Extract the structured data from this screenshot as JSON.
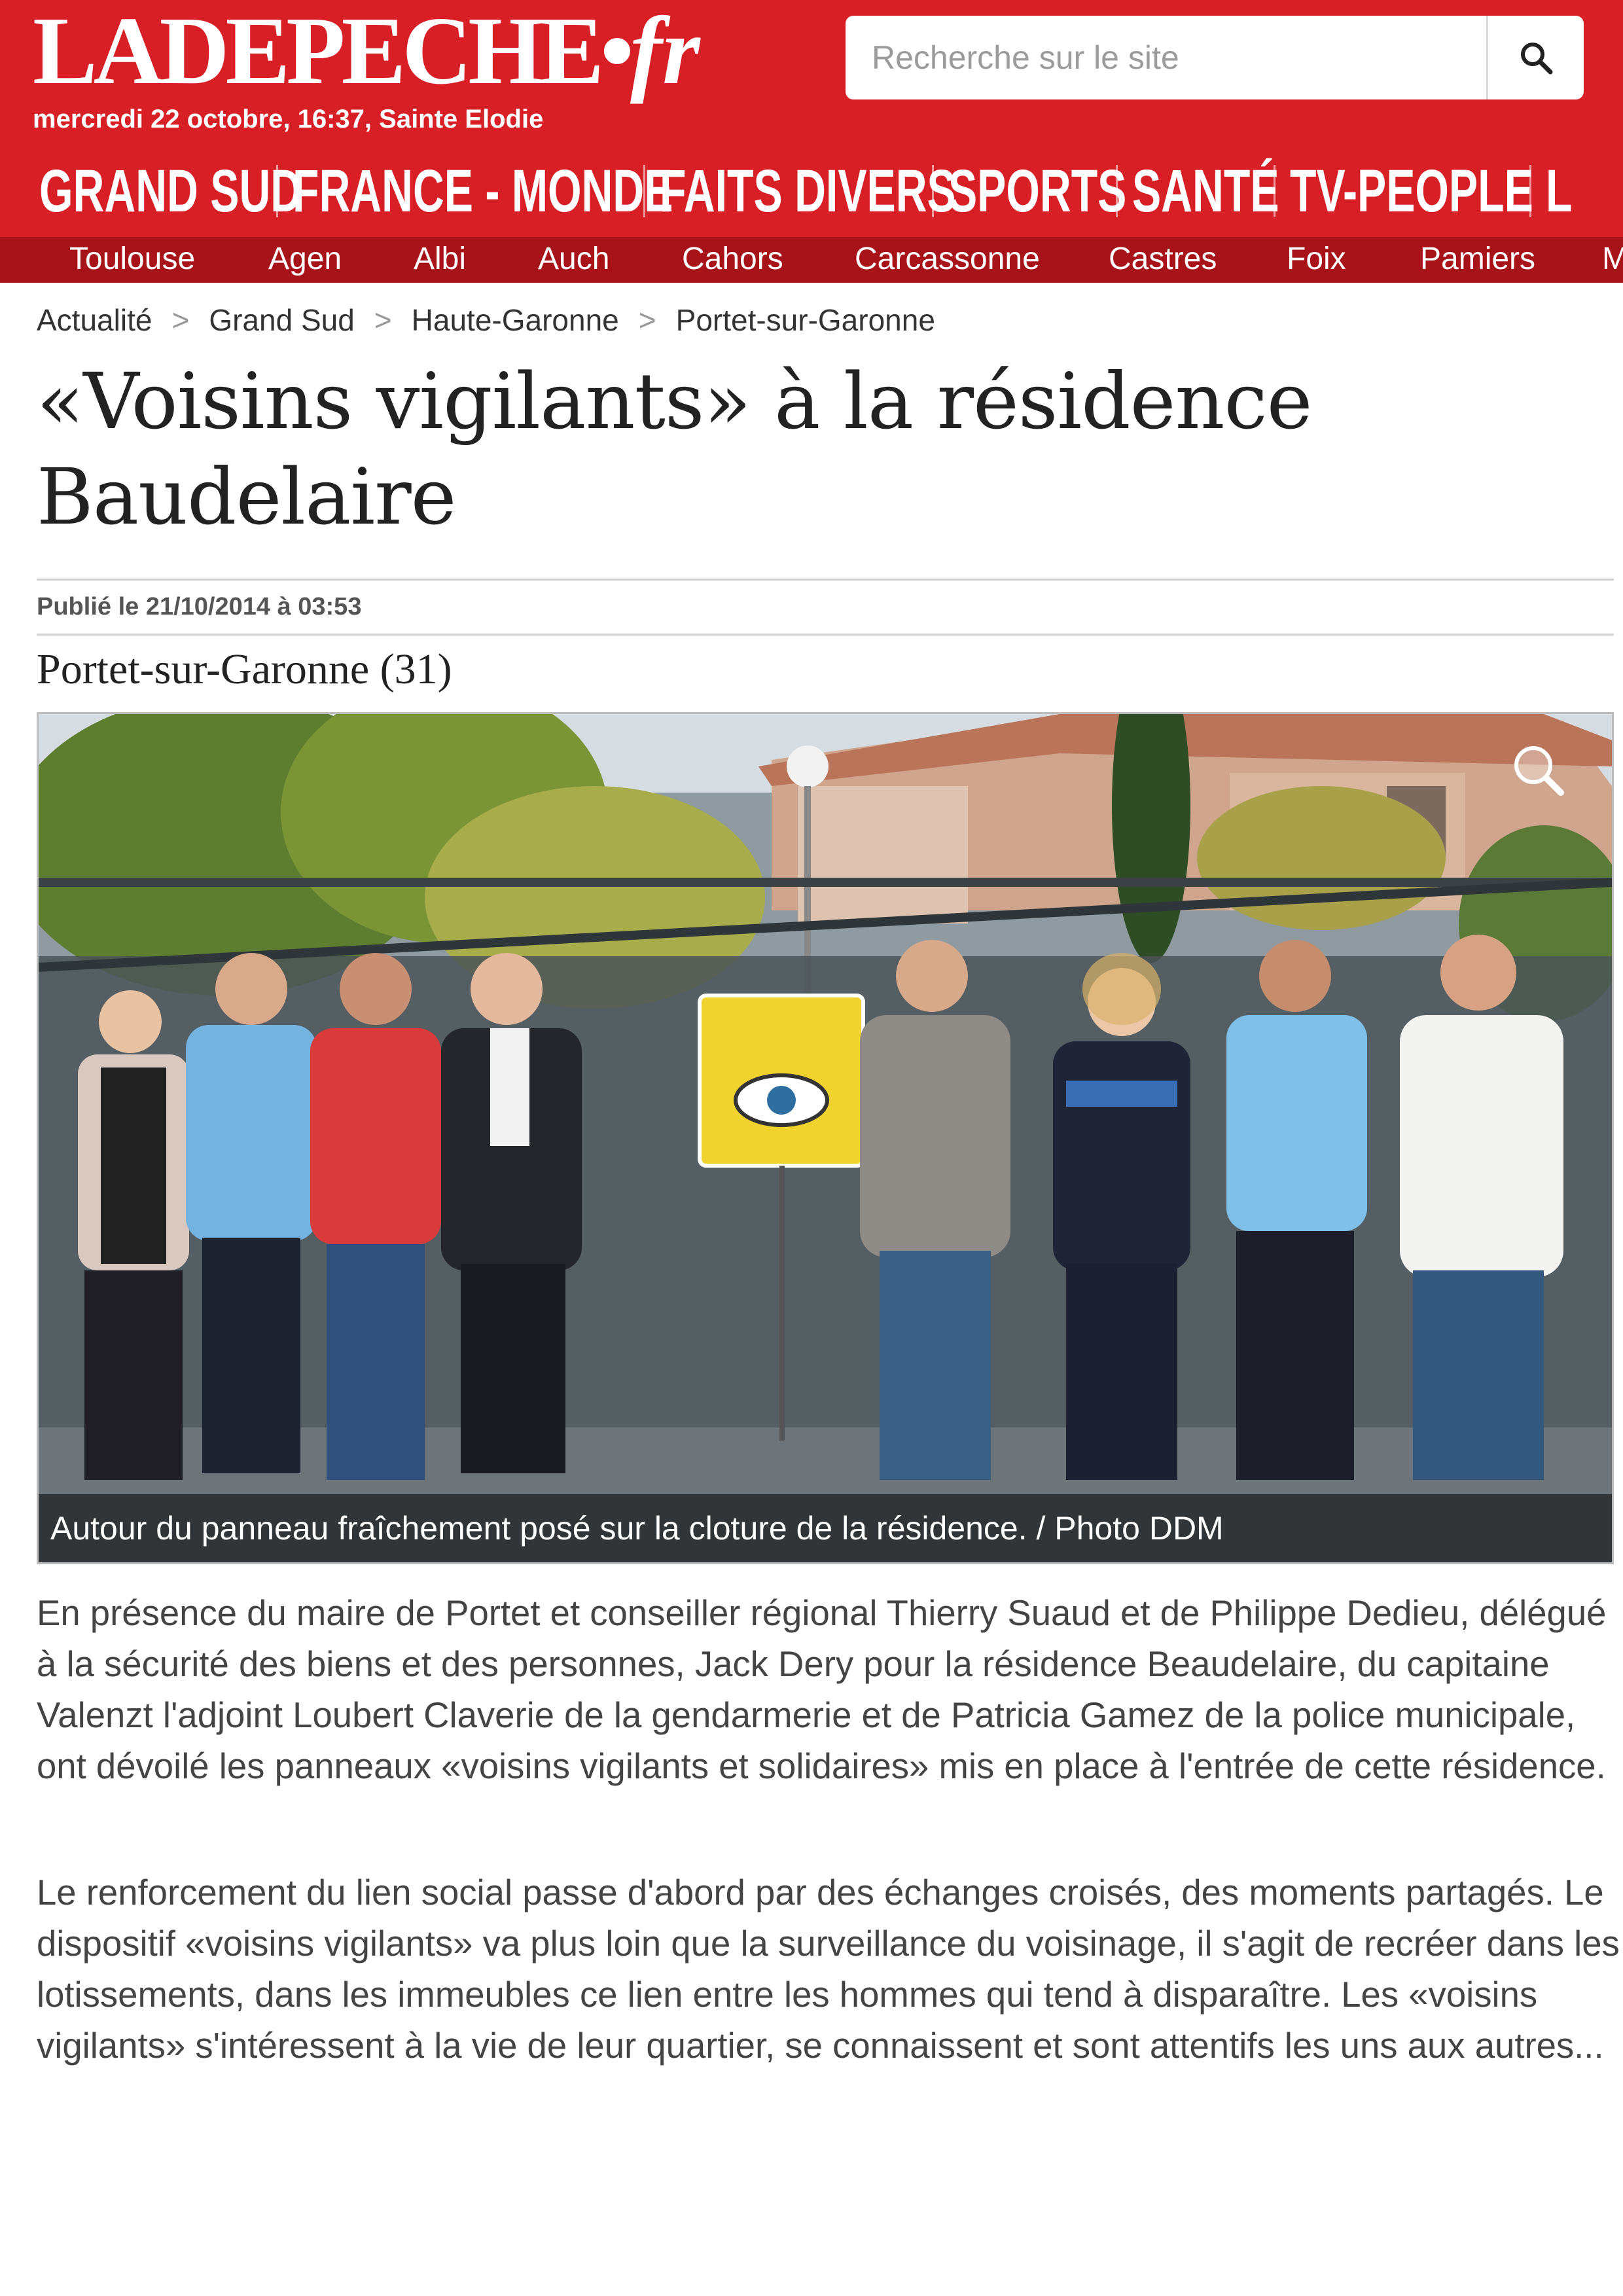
{
  "header": {
    "logo_main": "LADEPECHE",
    "logo_dot": "•",
    "logo_fr": "fr",
    "date_line": "mercredi 22 octobre, 16:37, Sainte Elodie",
    "search_placeholder": "Recherche sur le site",
    "search_icon": "magnifier-icon",
    "brand_color": "#d81f26",
    "subnav_color": "#a81219"
  },
  "main_nav": [
    "GRAND SUD",
    "FRANCE - MONDE",
    "FAITS DIVERS",
    "SPORTS",
    "SANTÉ",
    "TV-PEOPLE",
    "L"
  ],
  "sub_nav": [
    "Toulouse",
    "Agen",
    "Albi",
    "Auch",
    "Cahors",
    "Carcassonne",
    "Castres",
    "Foix",
    "Pamiers",
    "M"
  ],
  "breadcrumb": [
    "Actualité",
    "Grand Sud",
    "Haute-Garonne",
    "Portet-sur-Garonne"
  ],
  "breadcrumb_separator": ">",
  "article": {
    "title": "«Voisins vigilants» à la résidence Baudelaire",
    "published": "Publié le 21/10/2014 à 03:53",
    "location": "Portet-sur-Garonne (31)",
    "photo_caption": "Autour du panneau fraîchement posé sur la cloture de la résidence. / Photo DDM",
    "paragraphs": [
      "En présence du maire de Portet et conseiller régional Thierry Suaud et de Philippe Dedieu, délégué à la sécurité des biens et des personnes, Jack Dery pour la résidence Beaudelaire, du capitaine Valenzt l'adjoint Loubert Claverie de la gendarmerie et de Patricia Gamez de la police municipale, ont dévoilé les panneaux «voisins vigilants et solidaires» mis en place à l'entrée de cette résidence.",
      "Le renforcement du lien social passe d'abord par des échanges croisés, des moments partagés. Le dispositif «voisins vigilants» va plus loin que la surveillance du voisinage, il s'agit de recréer dans les lotissements, dans les immeubles ce lien entre les hommes qui tend à disparaître. Les «voisins vigilants» s'intéressent à la vie de leur quartier, se connaissent et sont attentifs les uns aux autres..."
    ]
  }
}
